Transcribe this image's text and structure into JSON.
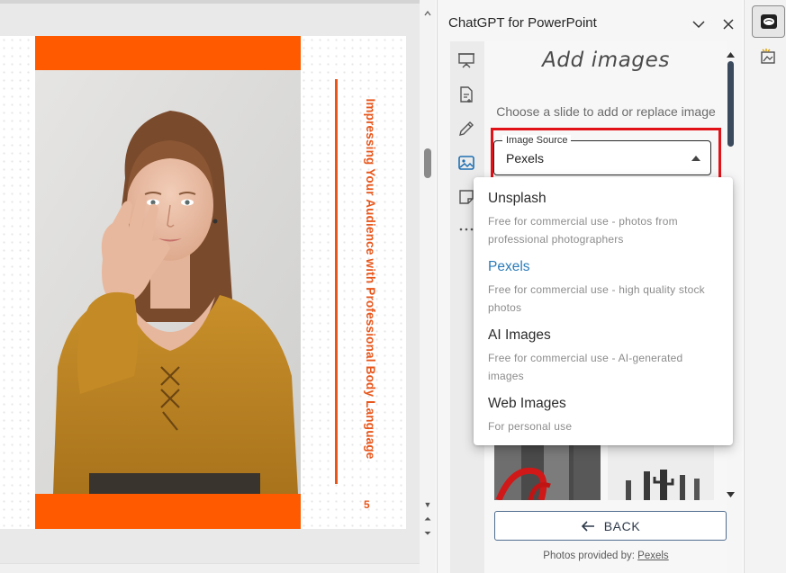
{
  "slide": {
    "vertical_title": "Impressing Your Audience with Professional Body Language",
    "slide_number": "5",
    "accent_color": "#ff5a00"
  },
  "task_pane": {
    "title": "ChatGPT for PowerPoint",
    "nav": [
      "presentation-icon",
      "add-page-icon",
      "pencil-icon",
      "image-icon",
      "sticky-note-icon",
      "more-icon"
    ],
    "heading": "Add images",
    "subtitle": "Choose a slide to add or replace image",
    "image_source": {
      "label": "Image Source",
      "value": "Pexels"
    },
    "back_label": "BACK",
    "credits_prefix": "Photos provided by:",
    "credits_link": "Pexels"
  },
  "dropdown": {
    "options": [
      {
        "title": "Unsplash",
        "description": "Free for commercial use - photos from professional photographers",
        "selected": false
      },
      {
        "title": "Pexels",
        "description": "Free for commercial use - high quality stock photos",
        "selected": true
      },
      {
        "title": "AI Images",
        "description": "Free for commercial use - AI-generated images",
        "selected": false
      },
      {
        "title": "Web Images",
        "description": "For personal use",
        "selected": false
      }
    ],
    "selected_color": "#2a7bb8"
  },
  "highlight_color": "#e11218"
}
